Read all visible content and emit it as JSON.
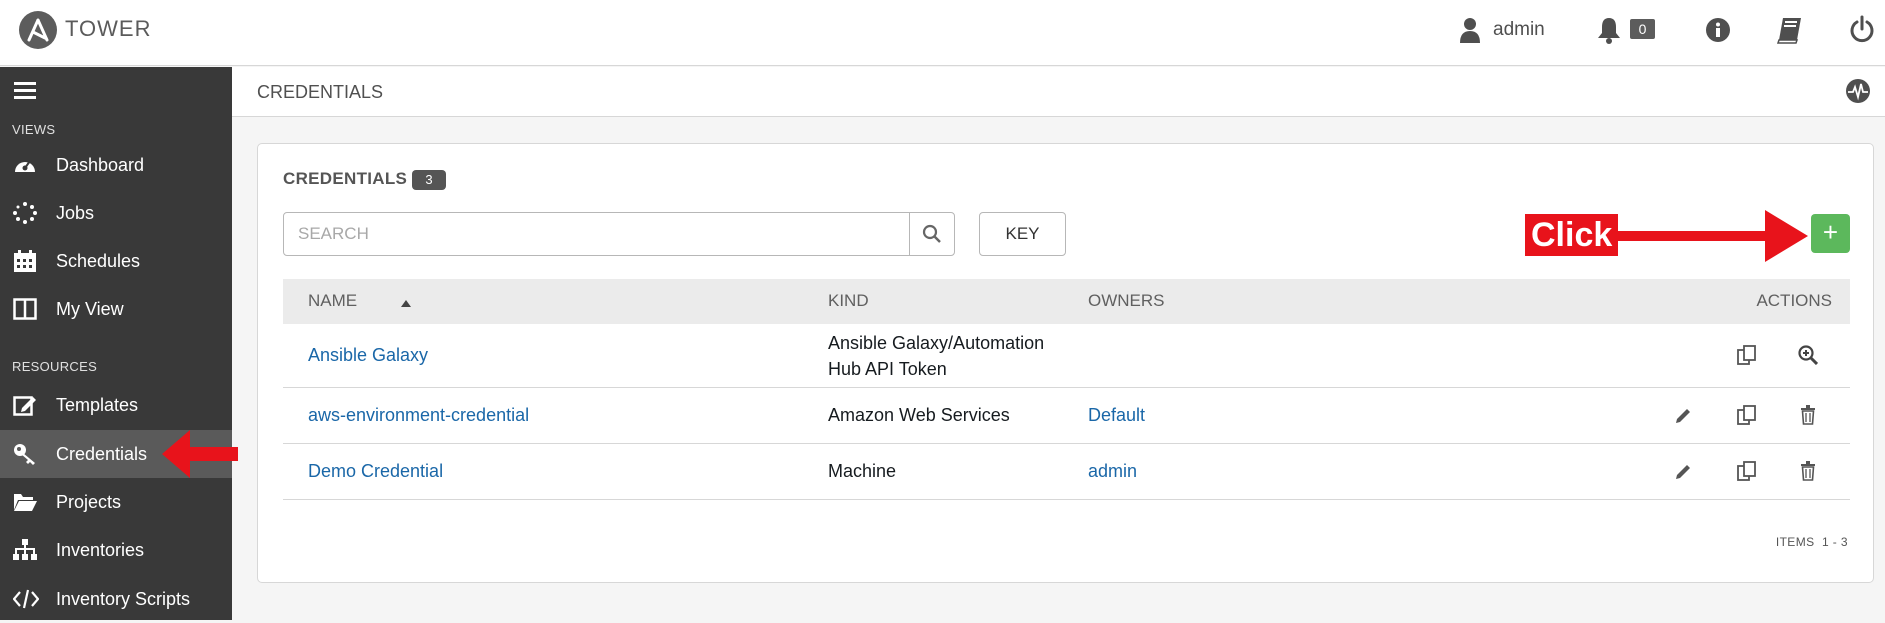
{
  "header": {
    "brand": "TOWER",
    "user": "admin",
    "notification_count": "0"
  },
  "sidebar": {
    "views_label": "VIEWS",
    "resources_label": "RESOURCES",
    "views": [
      {
        "label": "Dashboard",
        "icon": "dashboard-icon"
      },
      {
        "label": "Jobs",
        "icon": "jobs-spinner-icon"
      },
      {
        "label": "Schedules",
        "icon": "calendar-icon"
      },
      {
        "label": "My View",
        "icon": "columns-icon"
      }
    ],
    "resources": [
      {
        "label": "Templates",
        "icon": "edit-icon"
      },
      {
        "label": "Credentials",
        "icon": "key-icon",
        "active": true
      },
      {
        "label": "Projects",
        "icon": "folder-icon"
      },
      {
        "label": "Inventories",
        "icon": "sitemap-icon"
      },
      {
        "label": "Inventory Scripts",
        "icon": "code-icon"
      }
    ]
  },
  "breadcrumb": "CREDENTIALS",
  "panel": {
    "title": "CREDENTIALS",
    "count": "3",
    "search_placeholder": "SEARCH",
    "key_label": "KEY",
    "add_label": "+",
    "annotation": "Click",
    "columns": {
      "name": "NAME",
      "kind": "KIND",
      "owners": "OWNERS",
      "actions": "ACTIONS"
    },
    "rows": [
      {
        "name": "Ansible Galaxy",
        "kind_line1": "Ansible Galaxy/Automation",
        "kind_line2": "Hub API Token",
        "owner": "",
        "actions": [
          "copy",
          "view"
        ]
      },
      {
        "name": "aws-environment-credential",
        "kind_line1": "Amazon Web Services",
        "kind_line2": "",
        "owner": "Default",
        "actions": [
          "edit",
          "copy",
          "delete"
        ]
      },
      {
        "name": "Demo Credential",
        "kind_line1": "Machine",
        "kind_line2": "",
        "owner": "admin",
        "actions": [
          "edit",
          "copy",
          "delete"
        ]
      }
    ],
    "items_label": "ITEMS  1 - 3"
  },
  "colors": {
    "sidebar": "#393939",
    "active": "#5a5a5a",
    "link": "#1a67a8",
    "add": "#5cb85c",
    "annotation": "#e8131b"
  }
}
